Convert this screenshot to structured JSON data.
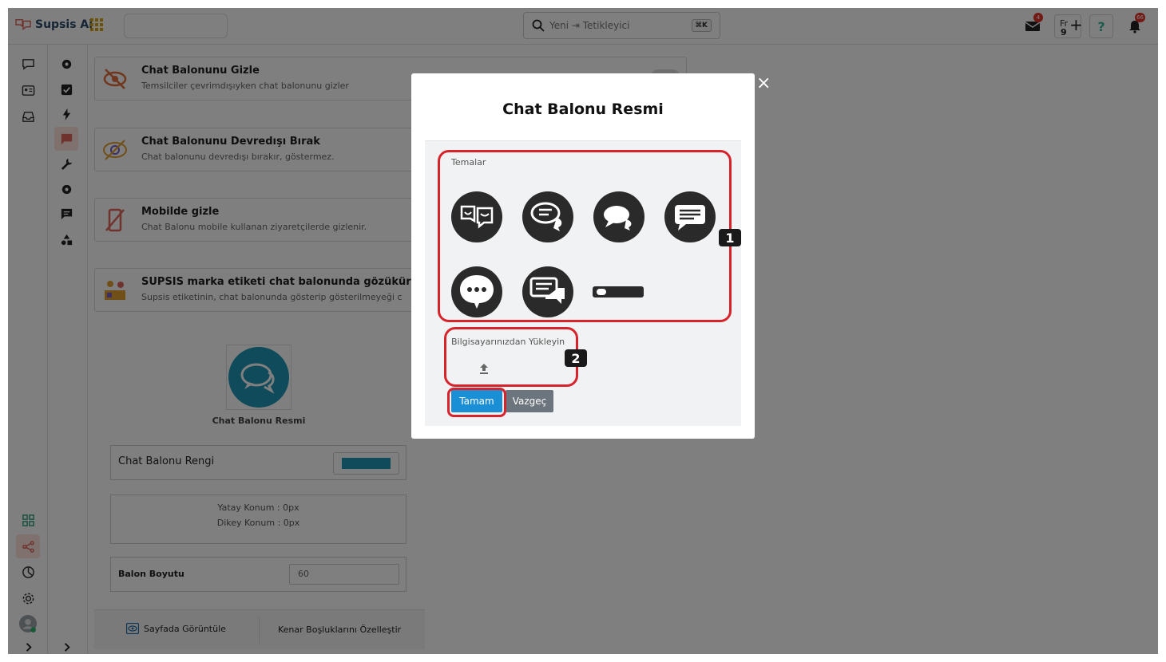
{
  "app": {
    "name": "Supsis Ai"
  },
  "search": {
    "placeholder": "Yeni ⇥ Tetikleyici",
    "shortcut": "⌘K"
  },
  "topbar": {
    "mail_badge": "4",
    "notif_badge": "66",
    "fr_label": "Fr",
    "fr_count": "9",
    "help": "?"
  },
  "settings": [
    {
      "title": "Chat Balonunu Gizle",
      "desc": "Temsilciler çevrimdışıyken chat balonunu gizler"
    },
    {
      "title": "Chat Balonunu Devredışı Bırak",
      "desc": "Chat balonunu devredışı bırakır, göstermez."
    },
    {
      "title": "Mobilde gizle",
      "desc": "Chat Balonu mobile kullanan ziyaretçilerde gizlenir."
    },
    {
      "title": "SUPSIS marka etiketi chat balonunda gözükür",
      "desc": "Supsis etiketinin, chat balonunda gösterip gösterilmeyeği c"
    }
  ],
  "preview": {
    "label": "Chat Balonu Resmi"
  },
  "color": {
    "label": "Chat Balonu Rengi",
    "value": "#1f96b5"
  },
  "position": {
    "horizontal": "Yatay Konum : 0px",
    "vertical": "Dikey Konum : 0px"
  },
  "size": {
    "label": "Balon Boyutu",
    "value": "60"
  },
  "bottom": {
    "view": "Sayfada Görüntüle",
    "margins": "Kenar Boşluklarını Özelleştir"
  },
  "modal": {
    "title": "Chat Balonu Resmi",
    "themes_label": "Temalar",
    "upload_label": "Bilgisayarınızdan Yükleyin",
    "ok": "Tamam",
    "cancel": "Vazgeç",
    "close": "×"
  },
  "annotations": [
    "1",
    "2"
  ],
  "colors": {
    "accent_red": "#d7232c",
    "ok_blue": "#1a8fd6",
    "brand": "#e0645a"
  }
}
